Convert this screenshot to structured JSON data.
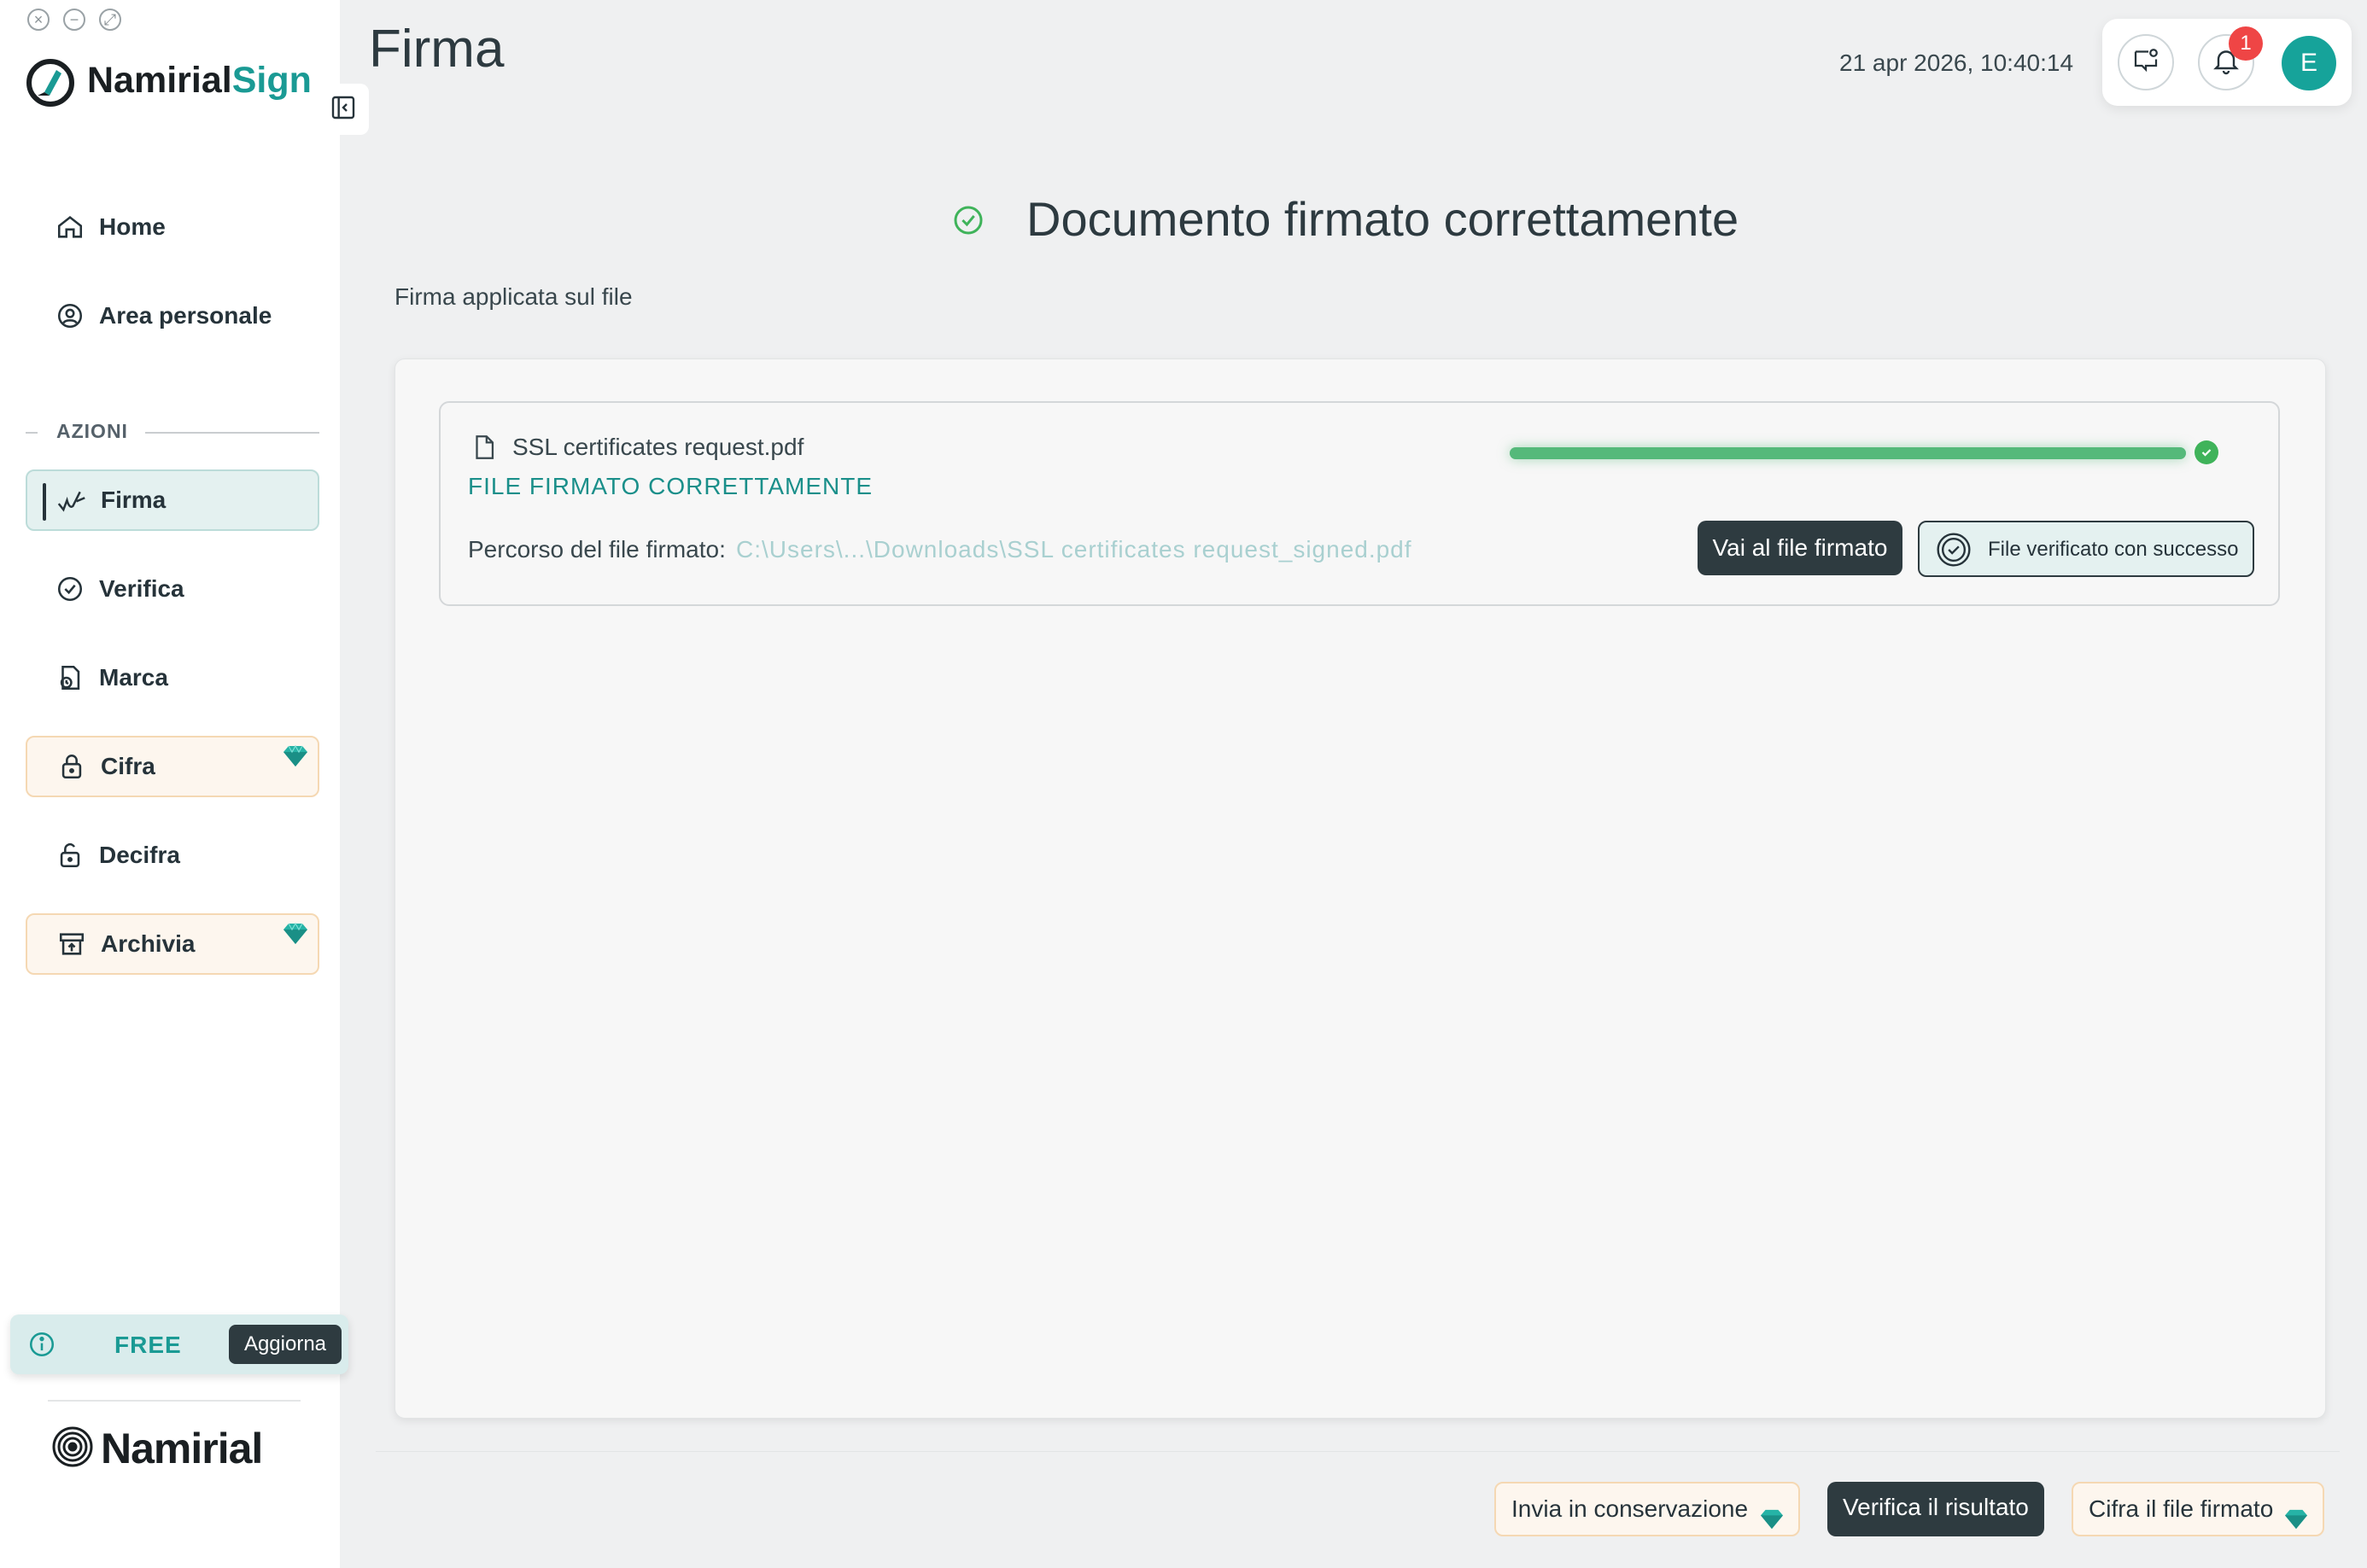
{
  "app": {
    "brand_prefix": "Namirial",
    "brand_suffix": "Sign",
    "footer_brand": "Namirial"
  },
  "sidebar": {
    "items": [
      {
        "label": "Home",
        "icon": "home-icon"
      },
      {
        "label": "Area personale",
        "icon": "user-circle-icon"
      }
    ],
    "section_label": "AZIONI",
    "actions": [
      {
        "label": "Firma",
        "icon": "signature-icon",
        "active": true
      },
      {
        "label": "Verifica",
        "icon": "check-badge-icon"
      },
      {
        "label": "Marca",
        "icon": "timestamp-icon"
      },
      {
        "label": "Cifra",
        "icon": "lock-icon",
        "premium": true
      },
      {
        "label": "Decifra",
        "icon": "unlock-icon"
      },
      {
        "label": "Archivia",
        "icon": "archive-icon",
        "premium": true
      }
    ],
    "plan": {
      "label": "FREE",
      "upgrade": "Aggiorna"
    }
  },
  "header": {
    "title": "Firma",
    "datetime": "21 apr 2026, 10:40:14",
    "notifications_count": "1",
    "avatar_initial": "E"
  },
  "main": {
    "success_title": "Documento firmato correttamente",
    "subtitle": "Firma applicata sul file",
    "file": {
      "name": "SSL certificates request.pdf",
      "status": "FILE FIRMATO CORRETTAMENTE",
      "path_label": "Percorso del file firmato:",
      "path_value": "C:\\Users\\...\\Downloads\\SSL certificates request_signed.pdf",
      "progress_percent": 100,
      "goto_button": "Vai al file firmato",
      "verified_button": "File verificato con successo"
    }
  },
  "footer_actions": {
    "conservazione": "Invia in conservazione",
    "verifica": "Verifica il risultato",
    "cifra": "Cifra il file firmato"
  },
  "colors": {
    "accent": "#1a9a94",
    "dark": "#2e3b40",
    "success": "#3fb35a",
    "premium_bg": "#fdf6ee",
    "badge": "#ef4545"
  }
}
